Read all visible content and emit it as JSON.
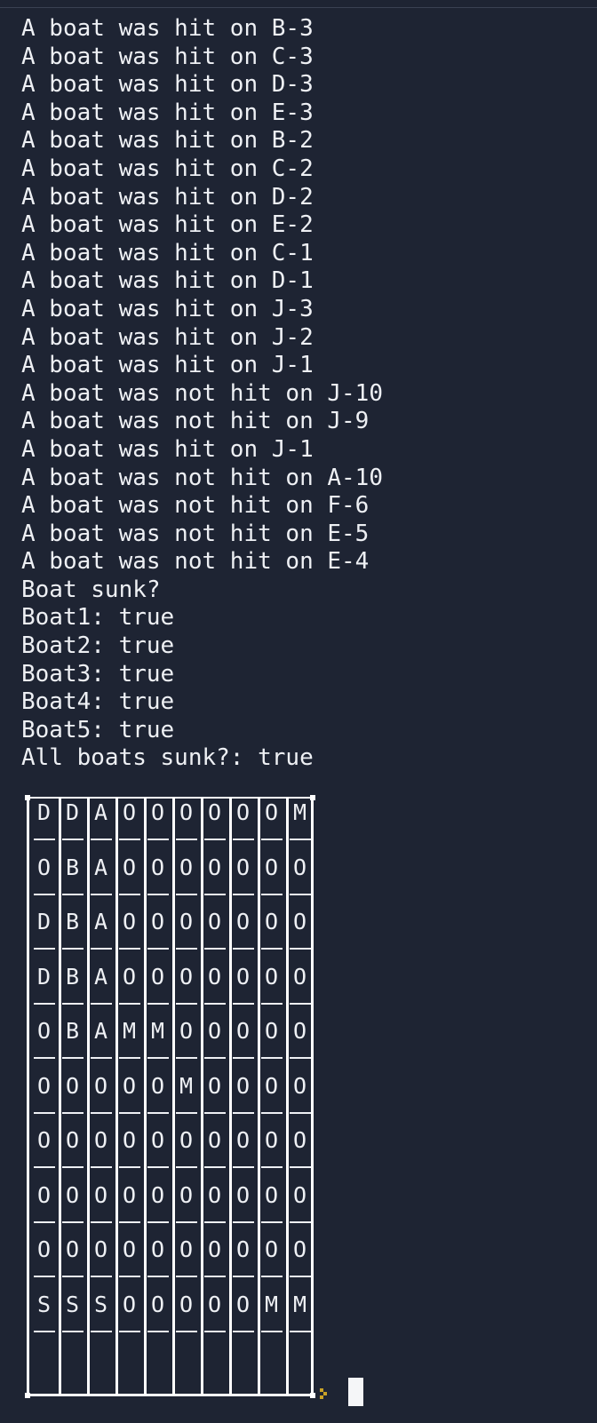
{
  "terminal": {
    "log_lines": [
      "A boat was hit on B-3",
      "A boat was hit on C-3",
      "A boat was hit on D-3",
      "A boat was hit on E-3",
      "A boat was hit on B-2",
      "A boat was hit on C-2",
      "A boat was hit on D-2",
      "A boat was hit on E-2",
      "A boat was hit on C-1",
      "A boat was hit on D-1",
      "A boat was hit on J-3",
      "A boat was hit on J-2",
      "A boat was hit on J-1",
      "A boat was not hit on J-10",
      "A boat was not hit on J-9",
      "A boat was hit on J-1",
      "A boat was not hit on A-10",
      "A boat was not hit on F-6",
      "A boat was not hit on E-5",
      "A boat was not hit on E-4",
      "Boat sunk?",
      "Boat1: true",
      "Boat2: true",
      "Boat3: true",
      "Boat4: true",
      "Boat5: true",
      "All boats sunk?: true"
    ],
    "board": {
      "rows": [
        [
          "D",
          "D",
          "A",
          "O",
          "O",
          "O",
          "O",
          "O",
          "O",
          "M"
        ],
        [
          "O",
          "B",
          "A",
          "O",
          "O",
          "O",
          "O",
          "O",
          "O",
          "O"
        ],
        [
          "D",
          "B",
          "A",
          "O",
          "O",
          "O",
          "O",
          "O",
          "O",
          "O"
        ],
        [
          "D",
          "B",
          "A",
          "O",
          "O",
          "O",
          "O",
          "O",
          "O",
          "O"
        ],
        [
          "O",
          "B",
          "A",
          "M",
          "M",
          "O",
          "O",
          "O",
          "O",
          "O"
        ],
        [
          "O",
          "O",
          "O",
          "O",
          "O",
          "M",
          "O",
          "O",
          "O",
          "O"
        ],
        [
          "O",
          "O",
          "O",
          "O",
          "O",
          "O",
          "O",
          "O",
          "O",
          "O"
        ],
        [
          "O",
          "O",
          "O",
          "O",
          "O",
          "O",
          "O",
          "O",
          "O",
          "O"
        ],
        [
          "O",
          "O",
          "O",
          "O",
          "O",
          "O",
          "O",
          "O",
          "O",
          "O"
        ],
        [
          "S",
          "S",
          "S",
          "O",
          "O",
          "O",
          "O",
          "O",
          "M",
          "M"
        ]
      ]
    },
    "prompt_icon": "prompt-arrow-icon",
    "colors": {
      "background": "#1e2433",
      "text": "#eef0f4",
      "board_lines": "#ffffff",
      "prompt_arrow": "#c9a227",
      "cursor": "#f5f6f8"
    }
  }
}
